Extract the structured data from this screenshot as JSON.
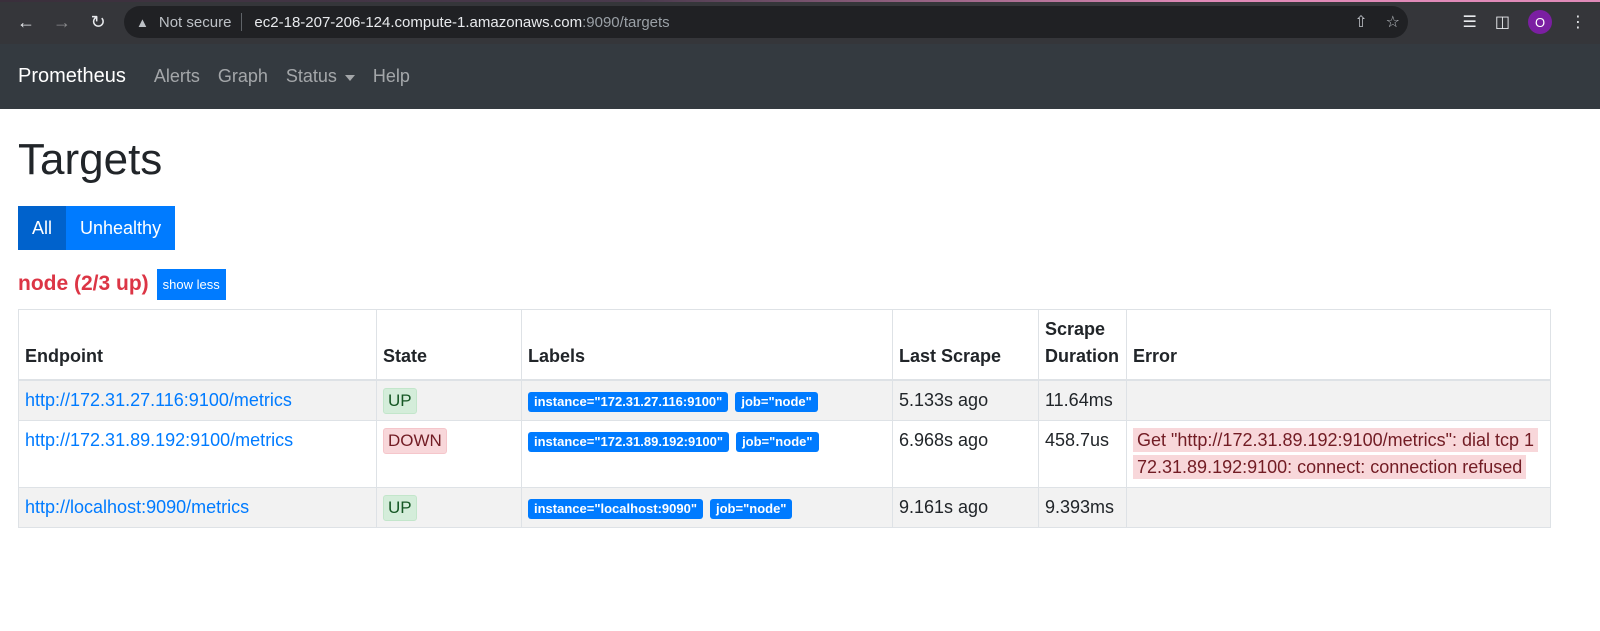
{
  "browser": {
    "security_label": "Not secure",
    "url_host": "ec2-18-207-206-124.compute-1.amazonaws.com",
    "url_path": ":9090/targets",
    "profile_initial": "O"
  },
  "navbar": {
    "brand": "Prometheus",
    "links": [
      "Alerts",
      "Graph",
      "Status",
      "Help"
    ]
  },
  "page": {
    "title": "Targets",
    "filter_all": "All",
    "filter_unhealthy": "Unhealthy"
  },
  "group": {
    "title": "node (2/3 up)",
    "toggle_label": "show less",
    "columns": [
      "Endpoint",
      "State",
      "Labels",
      "Last Scrape",
      "Scrape Duration",
      "Error"
    ],
    "rows": [
      {
        "endpoint": "http://172.31.27.116:9100/metrics",
        "state": "UP",
        "label_instance": "instance=\"172.31.27.116:9100\"",
        "label_job": "job=\"node\"",
        "last_scrape": "5.133s ago",
        "duration": "11.64ms",
        "error": ""
      },
      {
        "endpoint": "http://172.31.89.192:9100/metrics",
        "state": "DOWN",
        "label_instance": "instance=\"172.31.89.192:9100\"",
        "label_job": "job=\"node\"",
        "last_scrape": "6.968s ago",
        "duration": "458.7us",
        "error": "Get \"http://172.31.89.192:9100/metrics\": dial tcp 172.31.89.192:9100: connect: connection refused"
      },
      {
        "endpoint": "http://localhost:9090/metrics",
        "state": "UP",
        "label_instance": "instance=\"localhost:9090\"",
        "label_job": "job=\"node\"",
        "last_scrape": "9.161s ago",
        "duration": "9.393ms",
        "error": ""
      }
    ]
  }
}
